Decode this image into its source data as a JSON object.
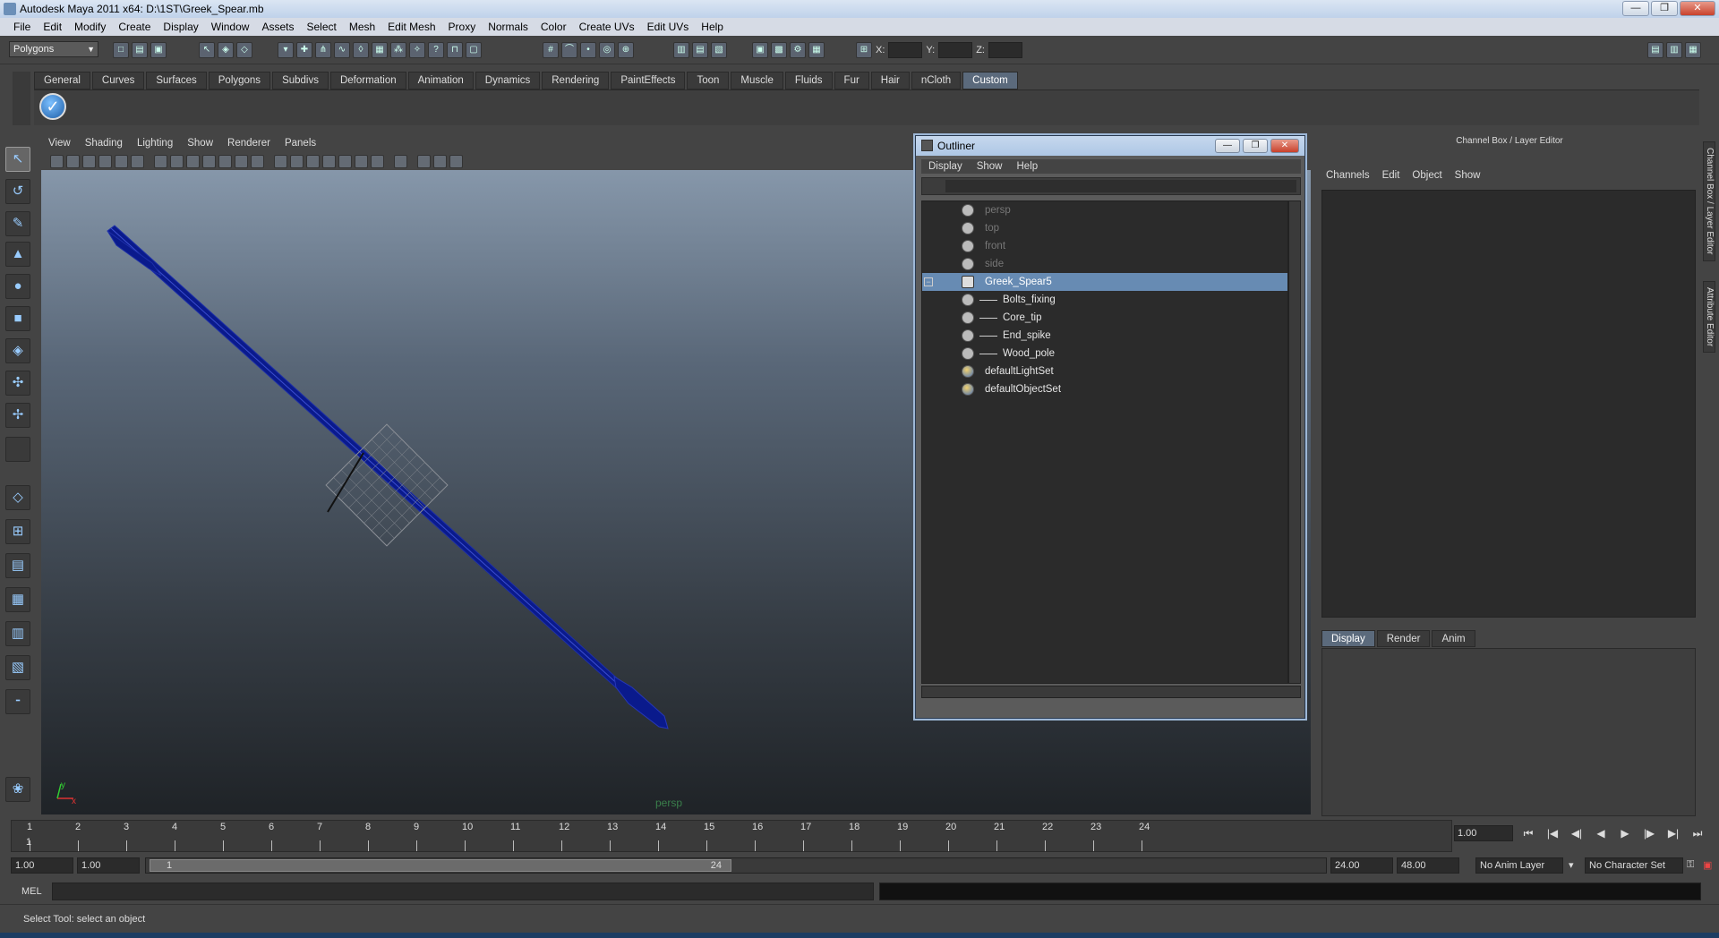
{
  "window": {
    "title": "Autodesk Maya 2011 x64: D:\\1ST\\Greek_Spear.mb",
    "buttons": [
      "—",
      "❐",
      "✕"
    ]
  },
  "menubar": [
    "File",
    "Edit",
    "Modify",
    "Create",
    "Display",
    "Window",
    "Assets",
    "Select",
    "Mesh",
    "Edit Mesh",
    "Proxy",
    "Normals",
    "Color",
    "Create UVs",
    "Edit UVs",
    "Help"
  ],
  "statusline": {
    "mode": "Polygons",
    "x_label": "X:",
    "y_label": "Y:",
    "z_label": "Z:"
  },
  "shelf": {
    "tabs": [
      "General",
      "Curves",
      "Surfaces",
      "Polygons",
      "Subdivs",
      "Deformation",
      "Animation",
      "Dynamics",
      "Rendering",
      "PaintEffects",
      "Toon",
      "Muscle",
      "Fluids",
      "Fur",
      "Hair",
      "nCloth",
      "Custom"
    ],
    "active_tab": "Custom"
  },
  "viewport": {
    "menu": [
      "View",
      "Shading",
      "Lighting",
      "Show",
      "Renderer",
      "Panels"
    ],
    "camera_label": "persp",
    "axis_x": "x",
    "axis_y": "y",
    "wire_color": "#0a1a8c"
  },
  "outliner": {
    "title": "Outliner",
    "menu": [
      "Display",
      "Show",
      "Help"
    ],
    "items": [
      {
        "label": "persp",
        "dim": true
      },
      {
        "label": "top",
        "dim": true
      },
      {
        "label": "front",
        "dim": true
      },
      {
        "label": "side",
        "dim": true
      },
      {
        "label": "Greek_Spear5",
        "selected": true
      },
      {
        "label": "Bolts_fixing",
        "child": true
      },
      {
        "label": "Core_tip",
        "child": true
      },
      {
        "label": "End_spike",
        "child": true
      },
      {
        "label": "Wood_pole",
        "child": true
      },
      {
        "label": "defaultLightSet"
      },
      {
        "label": "defaultObjectSet"
      }
    ],
    "selection_color": "#678bb3"
  },
  "channelbox": {
    "title": "Channel Box / Layer Editor",
    "menu": [
      "Channels",
      "Edit",
      "Object",
      "Show"
    ],
    "layer_tabs": [
      "Display",
      "Render",
      "Anim"
    ],
    "active_layer_tab": "Display",
    "side_tabs": [
      "Channel Box / Layer Editor",
      "Attribute Editor"
    ]
  },
  "timeslider": {
    "frames": [
      "1",
      "2",
      "3",
      "4",
      "5",
      "6",
      "7",
      "8",
      "9",
      "10",
      "11",
      "12",
      "13",
      "14",
      "15",
      "16",
      "17",
      "18",
      "19",
      "20",
      "21",
      "22",
      "23",
      "24"
    ],
    "current_frame": "1",
    "current_field": "1.00"
  },
  "range": {
    "start_time": "1.00",
    "playback_start": "1.00",
    "range_start_label": "1",
    "range_end_label": "24",
    "playback_end": "24.00",
    "end_time": "48.00",
    "anim_layer": "No Anim Layer",
    "character_set": "No Character Set"
  },
  "cmdline": {
    "label": "MEL"
  },
  "helpline": {
    "text": "Select Tool: select an object"
  }
}
